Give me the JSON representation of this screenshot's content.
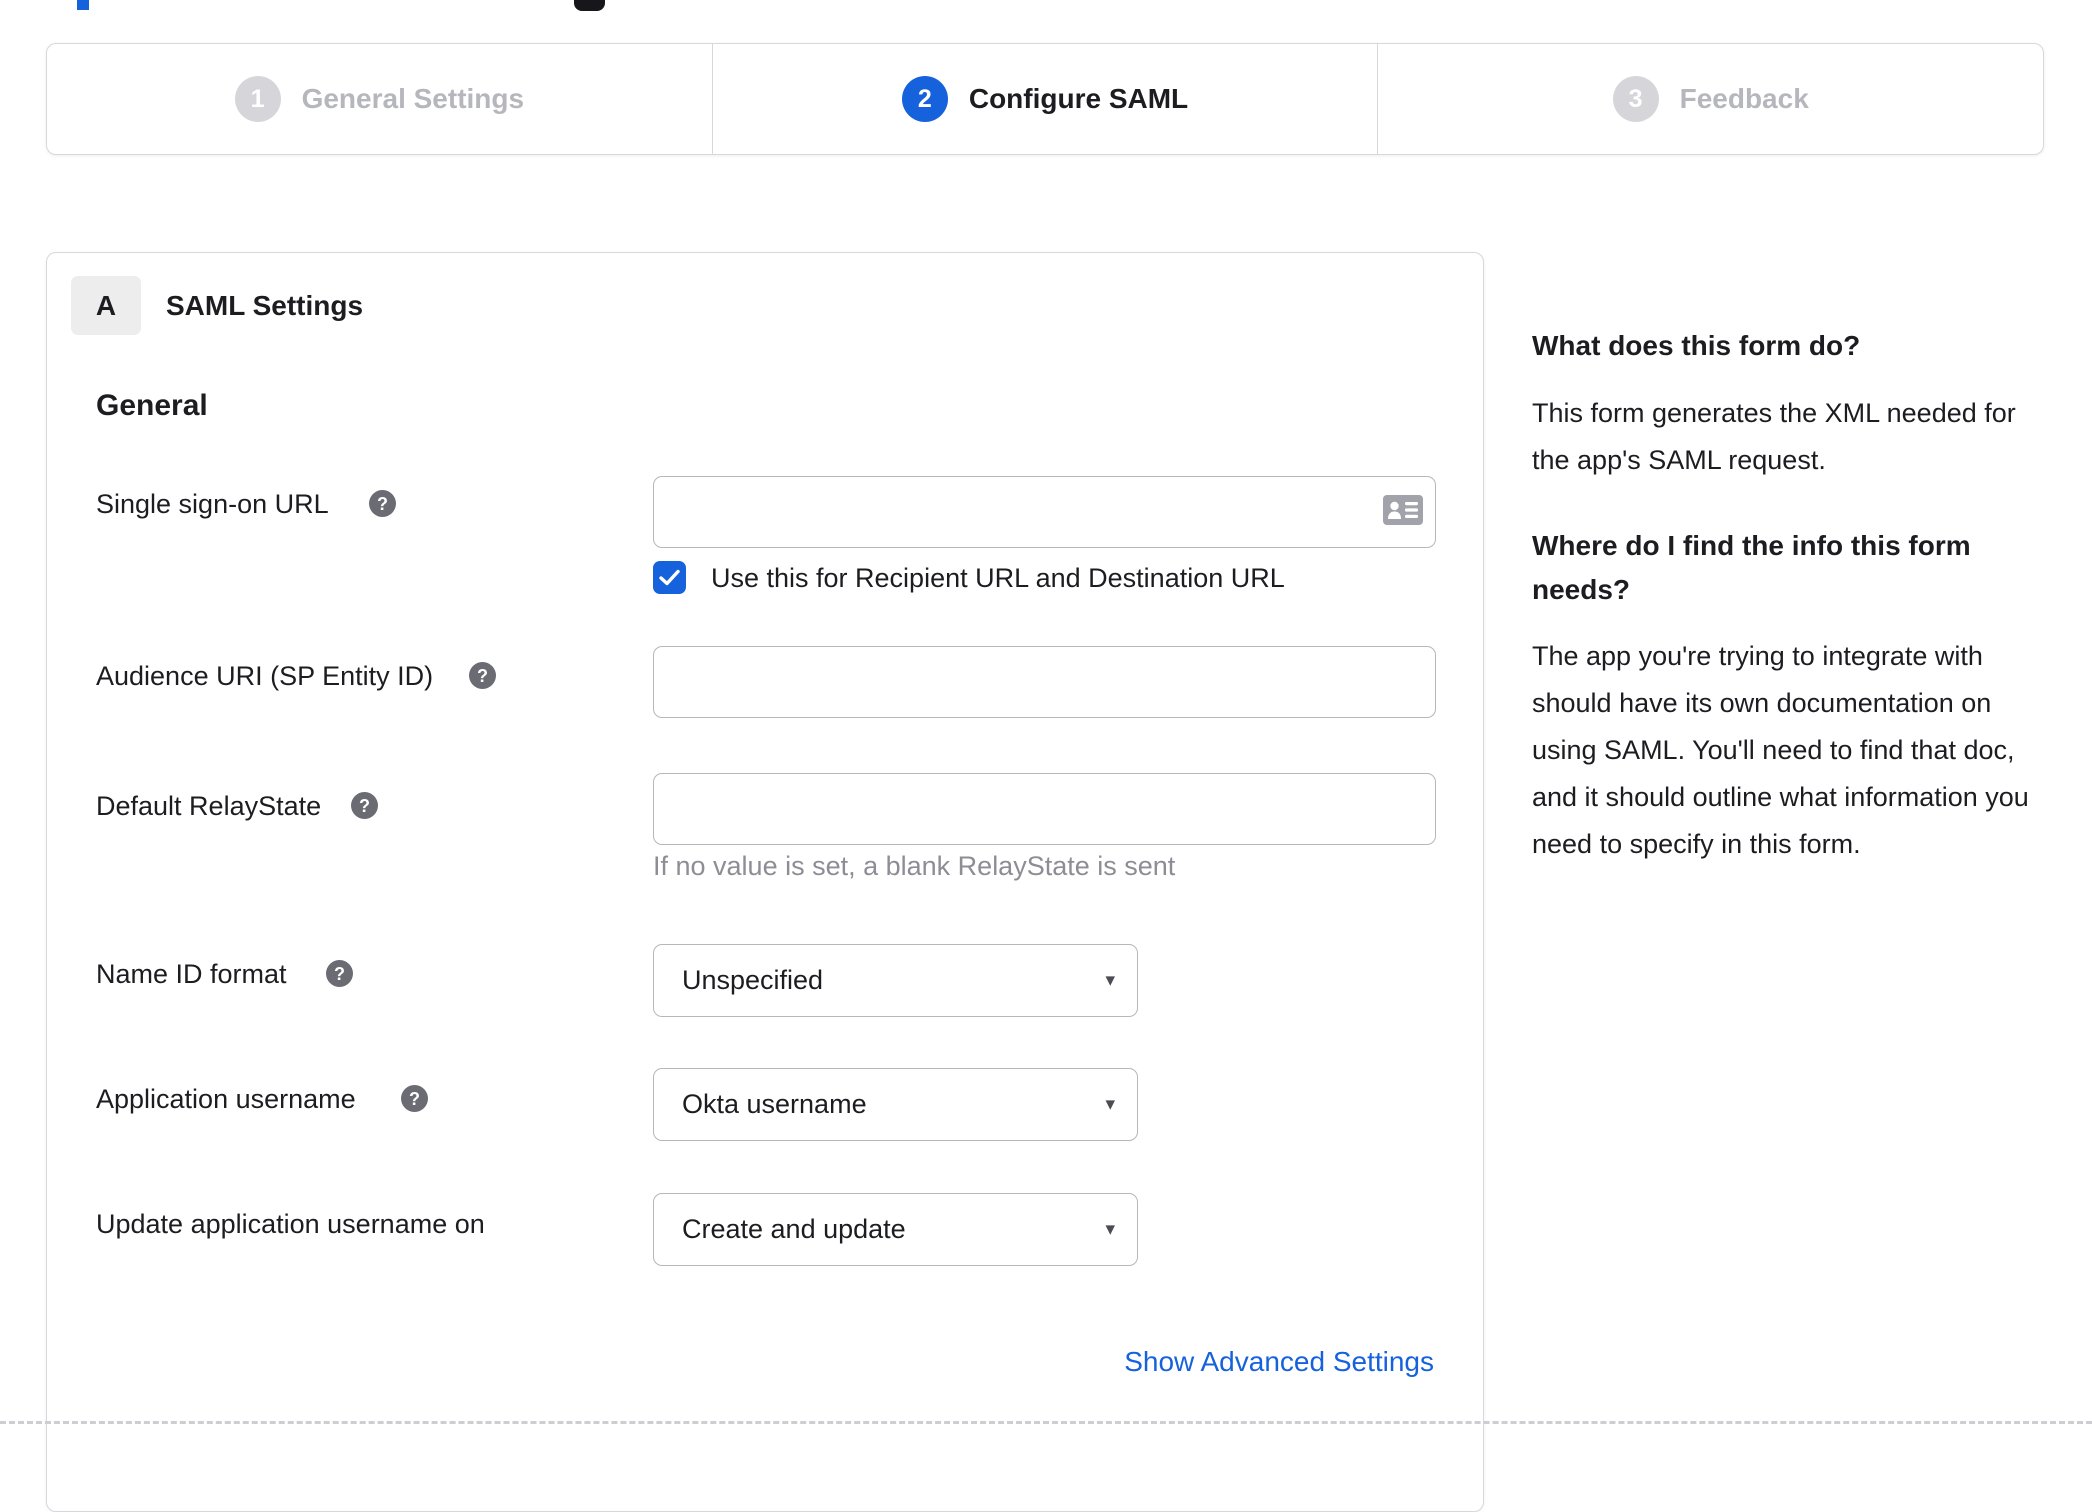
{
  "accent_color": "#1662dd",
  "glyphs": {
    "help": "?",
    "caret": "▾"
  },
  "top_fragments": {
    "blue": "cutoff-blue-element",
    "dark": "cutoff-dark-icon"
  },
  "stepper": {
    "steps": [
      {
        "number": "1",
        "label": "General Settings",
        "state": "inactive"
      },
      {
        "number": "2",
        "label": "Configure SAML",
        "state": "active"
      },
      {
        "number": "3",
        "label": "Feedback",
        "state": "inactive"
      }
    ]
  },
  "panel": {
    "badge": "A",
    "title": "SAML Settings",
    "group_title": "General",
    "fields": {
      "sso_url": {
        "label": "Single sign-on URL",
        "value": "",
        "checkbox_label": "Use this for Recipient URL and Destination URL",
        "checkbox_checked": true
      },
      "audience_uri": {
        "label": "Audience URI (SP Entity ID)",
        "value": ""
      },
      "relay_state": {
        "label": "Default RelayState",
        "value": "",
        "hint": "If no value is set, a blank RelayState is sent"
      },
      "name_id_format": {
        "label": "Name ID format",
        "value": "Unspecified"
      },
      "app_username": {
        "label": "Application username",
        "value": "Okta username"
      },
      "update_username": {
        "label": "Update application username on",
        "value": "Create and update"
      }
    },
    "advanced_link": "Show Advanced Settings"
  },
  "sidebar": {
    "heading1": "What does this form do?",
    "para1": "This form generates the XML needed for the app's SAML request.",
    "heading2": "Where do I find the info this form needs?",
    "para2": "The app you're trying to integrate with should have its own documentation on using SAML. You'll need to find that doc, and it should outline what information you need to specify in this form."
  }
}
